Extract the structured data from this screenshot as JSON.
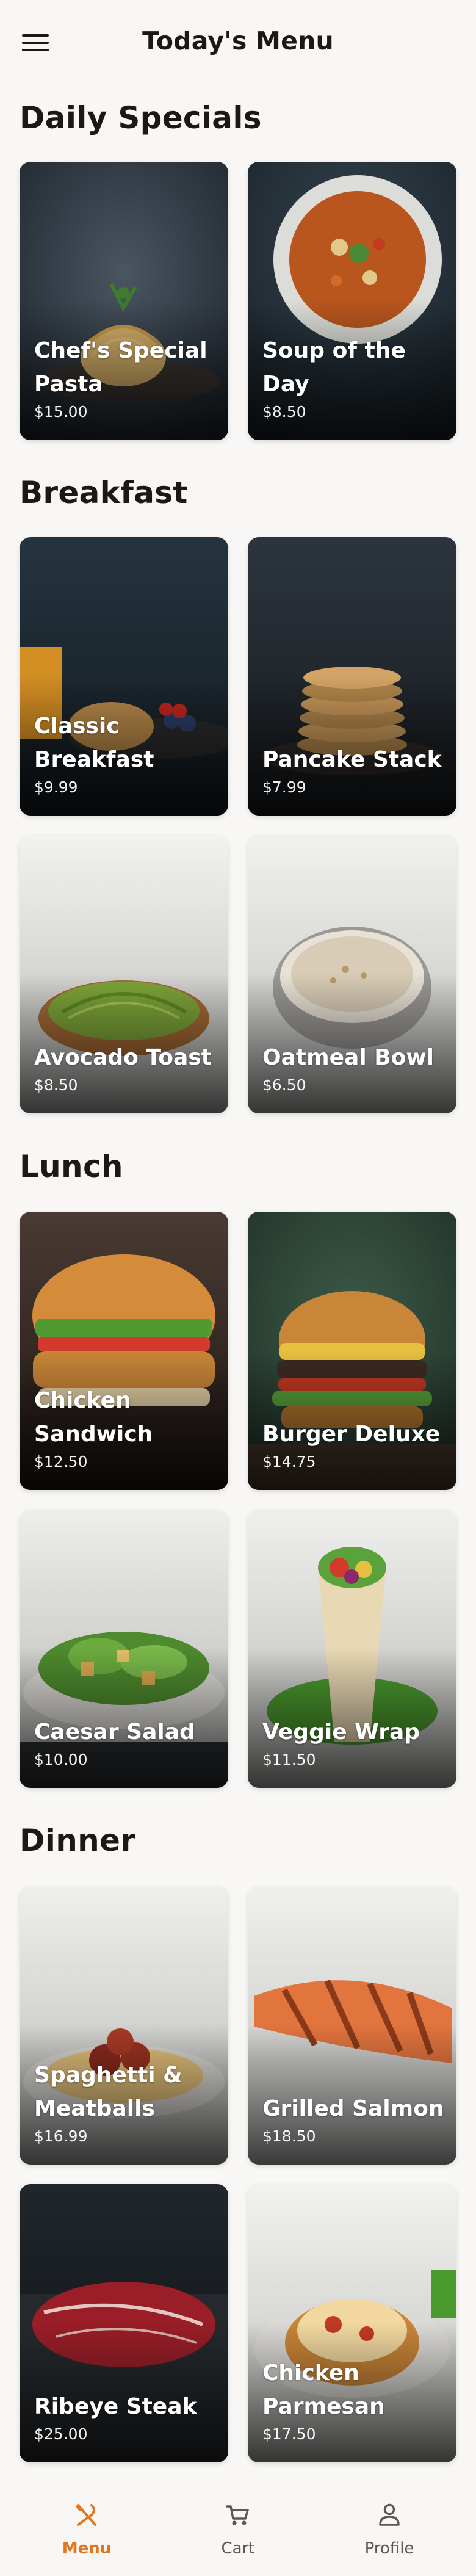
{
  "app": {
    "title": "Today's Menu",
    "accent_color": "#e0761f"
  },
  "header": {
    "menu_icon": "hamburger-menu-icon"
  },
  "sections": [
    {
      "title": "Daily Specials",
      "items": [
        {
          "name": "Chef's Special Pasta",
          "price": "$15.00"
        },
        {
          "name": "Soup of the Day",
          "price": "$8.50"
        }
      ]
    },
    {
      "title": "Breakfast",
      "items": [
        {
          "name": "Classic Breakfast",
          "price": "$9.99"
        },
        {
          "name": "Pancake Stack",
          "price": "$7.99"
        },
        {
          "name": "Avocado Toast",
          "price": "$8.50"
        },
        {
          "name": "Oatmeal Bowl",
          "price": "$6.50"
        }
      ]
    },
    {
      "title": "Lunch",
      "items": [
        {
          "name": "Chicken Sandwich",
          "price": "$12.50"
        },
        {
          "name": "Burger Deluxe",
          "price": "$14.75"
        },
        {
          "name": "Caesar Salad",
          "price": "$10.00"
        },
        {
          "name": "Veggie Wrap",
          "price": "$11.50"
        }
      ]
    },
    {
      "title": "Dinner",
      "items": [
        {
          "name": "Spaghetti & Meatballs",
          "price": "$16.99"
        },
        {
          "name": "Grilled Salmon",
          "price": "$18.50"
        },
        {
          "name": "Ribeye Steak",
          "price": "$25.00"
        },
        {
          "name": "Chicken Parmesan",
          "price": "$17.50"
        }
      ]
    }
  ],
  "bottom_nav": {
    "items": [
      {
        "label": "Menu",
        "icon": "fork-knife-icon",
        "active": true
      },
      {
        "label": "Cart",
        "icon": "cart-icon",
        "active": false
      },
      {
        "label": "Profile",
        "icon": "user-icon",
        "active": false
      }
    ]
  }
}
